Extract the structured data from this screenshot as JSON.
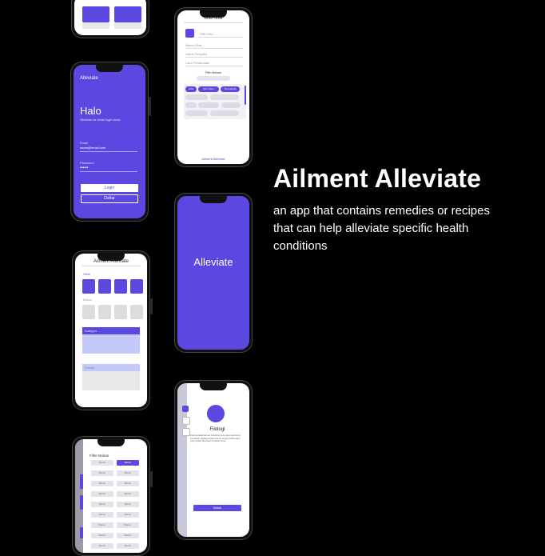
{
  "hero": {
    "title": "Ailment Alleviate",
    "description": "an app that contains remedies or recipes that can help alleviate specific health conditions"
  },
  "login": {
    "brand": "Alleviate",
    "greeting": "Halo",
    "subtitle": "Silahkan isi detail login anda",
    "email_label": "Email",
    "email_value": "nama@email.com",
    "password_label": "Password",
    "password_value": "••••••",
    "login_button": "Login",
    "register_button": "Daftar"
  },
  "create": {
    "title": "Buat Obat",
    "photo_label": "Pilih Foto",
    "field1": "Nama Obat",
    "field2": "Untuk Penyakit",
    "field3": "Cara Pembuatan",
    "ingredients_heading": "Pilih Bahan",
    "chips": [
      "Jahe",
      "Mint Daun",
      "Temulawak"
    ],
    "footer": "Ailment Alleviate"
  },
  "splash": {
    "brand": "Alleviate"
  },
  "home": {
    "title": "Ailment Alleviate",
    "section1": "Obat",
    "section2": "Bahan",
    "card1": "Kategori",
    "card2": "Favorit"
  },
  "detail": {
    "title": "Filologi",
    "body": "Filologi adalah ramuan tradisional yang dapat membantu meredakan gejala penyakit tertentu dengan bahan alami yang mudah ditemukan di sekitar rumah.",
    "button": "Masak"
  },
  "filter": {
    "title": "Filter Bahan",
    "rows": [
      [
        "Bahan",
        "Bahan"
      ],
      [
        "Bahan",
        "Bahan"
      ],
      [
        "Bahan",
        "Bahan"
      ],
      [
        "Bahan",
        "Bahan"
      ],
      [
        "Bahan",
        "Bahan"
      ],
      [
        "Bahan",
        "Bahan"
      ],
      [
        "Bahan",
        "Bahan"
      ],
      [
        "Bahan",
        "Bahan"
      ],
      [
        "Bahan",
        "Bahan"
      ]
    ]
  },
  "colors": {
    "accent": "#5b48e0",
    "light_accent": "#c3c9f8",
    "background": "#000000"
  }
}
